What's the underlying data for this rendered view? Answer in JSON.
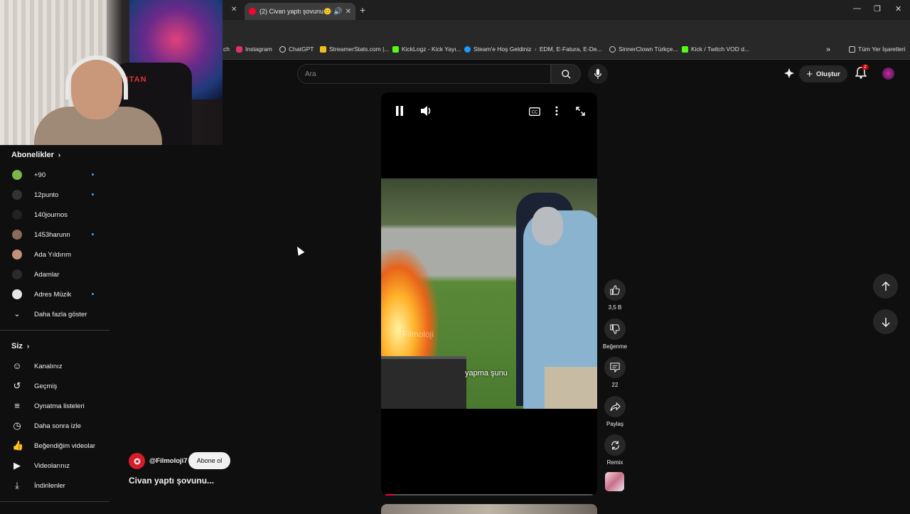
{
  "browser": {
    "active_tab_title": "(2) Civan yaptı şovunu🙂#...",
    "bookmarks": [
      {
        "label": "ch",
        "color": "#888888"
      },
      {
        "label": "Instagram",
        "color": "#e1306c"
      },
      {
        "label": "ChatGPT",
        "color": "#dddddd"
      },
      {
        "label": "StreamerStats.com |...",
        "color": "#f0c020"
      },
      {
        "label": "KickLogz - Kick Yayı...",
        "color": "#53fc18"
      },
      {
        "label": "Steam'e Hoş Geldiniz",
        "color": "#1b9cff"
      },
      {
        "label": "EDM, E-Fatura, E-De...",
        "color": "#d04040"
      },
      {
        "label": "SinnerClown Türkçe...",
        "color": "#cccccc"
      },
      {
        "label": "Kick / Twitch VOD d...",
        "color": "#53fc18"
      }
    ],
    "all_bookmarks": "Tüm Yer İşaretleri",
    "tab_overflow_glyph": "»"
  },
  "webcam": {
    "chair_brand": "TITAN"
  },
  "sidebar": {
    "subscriptions_title": "Abonelikler",
    "subscriptions": [
      {
        "name": "+90",
        "color": "#7ab648",
        "dot": true
      },
      {
        "name": "12punto",
        "color": "#333333",
        "dot": true
      },
      {
        "name": "140journos",
        "color": "#222222",
        "dot": false
      },
      {
        "name": "1453harunn",
        "color": "#8a6a5a",
        "dot": true
      },
      {
        "name": "Ada Yıldırım",
        "color": "#c4907a",
        "dot": false
      },
      {
        "name": "Adamlar",
        "color": "#2a2a2a",
        "dot": false
      },
      {
        "name": "Adres Müzik",
        "color": "#e8e8e8",
        "dot": true
      }
    ],
    "show_more": "Daha fazla göster",
    "you_title": "Siz",
    "you_items": [
      {
        "label": "Kanalınız",
        "icon": "user-icon",
        "glyph": "☺"
      },
      {
        "label": "Geçmiş",
        "icon": "history-icon",
        "glyph": "↺"
      },
      {
        "label": "Oynatma listeleri",
        "icon": "playlists-icon",
        "glyph": "≡"
      },
      {
        "label": "Daha sonra izle",
        "icon": "clock-icon",
        "glyph": "◷"
      },
      {
        "label": "Beğendiğim videolar",
        "icon": "thumbs-up-icon",
        "glyph": "👍"
      },
      {
        "label": "Videolarınız",
        "icon": "video-icon",
        "glyph": "▶"
      },
      {
        "label": "İndirilenler",
        "icon": "download-icon",
        "glyph": "⤓"
      }
    ]
  },
  "header": {
    "search_placeholder": "Ara",
    "create_label": "Oluştur",
    "notifications_count": "2"
  },
  "player": {
    "subtitle": "yapma şunu",
    "watermark": "Filmoloji",
    "progress": 0.04
  },
  "actions": {
    "likes": "3,5 B",
    "dislike_label": "Beğenme",
    "comments": "22",
    "share_label": "Paylaş",
    "remix_label": "Remix"
  },
  "channel": {
    "name": "@Filmoloji7",
    "subscribe_label": "Abone ol",
    "video_title": "Civan yaptı şovunu..."
  }
}
